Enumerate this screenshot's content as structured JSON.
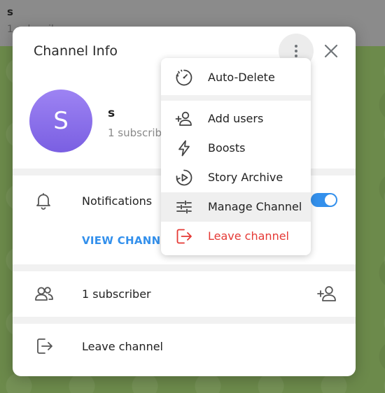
{
  "background_chat": {
    "title": "s",
    "subtitle": "1 subscriber"
  },
  "modal": {
    "title": "Channel Info",
    "channel": {
      "avatar_letter": "S",
      "name": "s",
      "subscribers_text": "1 subscriber"
    },
    "notifications": {
      "label": "Notifications",
      "enabled": true
    },
    "view_channel_label": "VIEW CHANNEL",
    "subscribers_row": {
      "label": "1 subscriber"
    },
    "leave_row": {
      "label": "Leave channel"
    }
  },
  "menu": {
    "items": [
      {
        "label": "Auto-Delete",
        "icon": "timer-icon"
      },
      {
        "label": "Add users",
        "icon": "add-user-icon"
      },
      {
        "label": "Boosts",
        "icon": "lightning-icon"
      },
      {
        "label": "Story Archive",
        "icon": "story-archive-icon"
      },
      {
        "label": "Manage Channel",
        "icon": "sliders-icon"
      },
      {
        "label": "Leave channel",
        "icon": "logout-icon",
        "danger": true
      }
    ]
  },
  "colors": {
    "accent": "#3390ec",
    "danger": "#e53935",
    "avatar_top": "#9d83f3",
    "avatar_bottom": "#7a5fe2"
  }
}
